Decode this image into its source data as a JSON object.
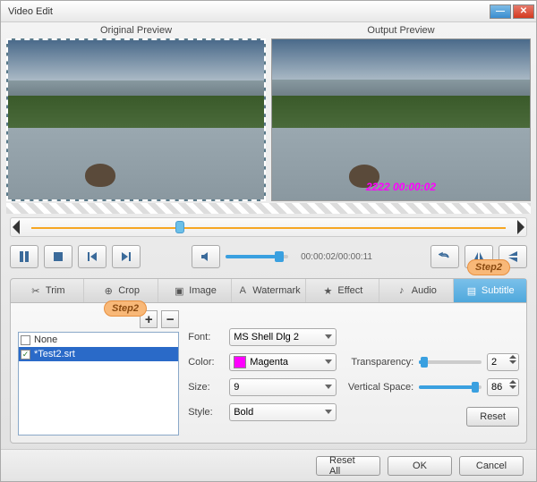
{
  "window": {
    "title": "Video Edit"
  },
  "preview": {
    "original_label": "Original Preview",
    "output_label": "Output Preview",
    "subtitle_overlay": "2222 00:00:02"
  },
  "playback": {
    "time_text": "00:00:02/00:00:11"
  },
  "tabs": {
    "items": [
      {
        "label": "Trim",
        "icon": "✂"
      },
      {
        "label": "Crop",
        "icon": "⊕"
      },
      {
        "label": "Image",
        "icon": "▣"
      },
      {
        "label": "Watermark",
        "icon": "A"
      },
      {
        "label": "Effect",
        "icon": "★"
      },
      {
        "label": "Audio",
        "icon": "♪"
      },
      {
        "label": "Subtitle",
        "icon": "▤"
      }
    ]
  },
  "callouts": {
    "step2": "Step2"
  },
  "subtitle_list": {
    "items": [
      {
        "name": "None",
        "checked": false,
        "selected": false
      },
      {
        "name": "*Test2.srt",
        "checked": true,
        "selected": true
      }
    ],
    "add_label": "+",
    "remove_label": "−"
  },
  "form": {
    "font_label": "Font:",
    "font_value": "MS Shell Dlg 2",
    "color_label": "Color:",
    "color_value": "Magenta",
    "color_hex": "#ff00ff",
    "size_label": "Size:",
    "size_value": "9",
    "style_label": "Style:",
    "style_value": "Bold"
  },
  "sliders": {
    "transparency_label": "Transparency:",
    "transparency_value": "2",
    "vertical_label": "Vertical Space:",
    "vertical_value": "86",
    "reset_label": "Reset"
  },
  "footer": {
    "reset_all": "Reset All",
    "ok": "OK",
    "cancel": "Cancel"
  }
}
